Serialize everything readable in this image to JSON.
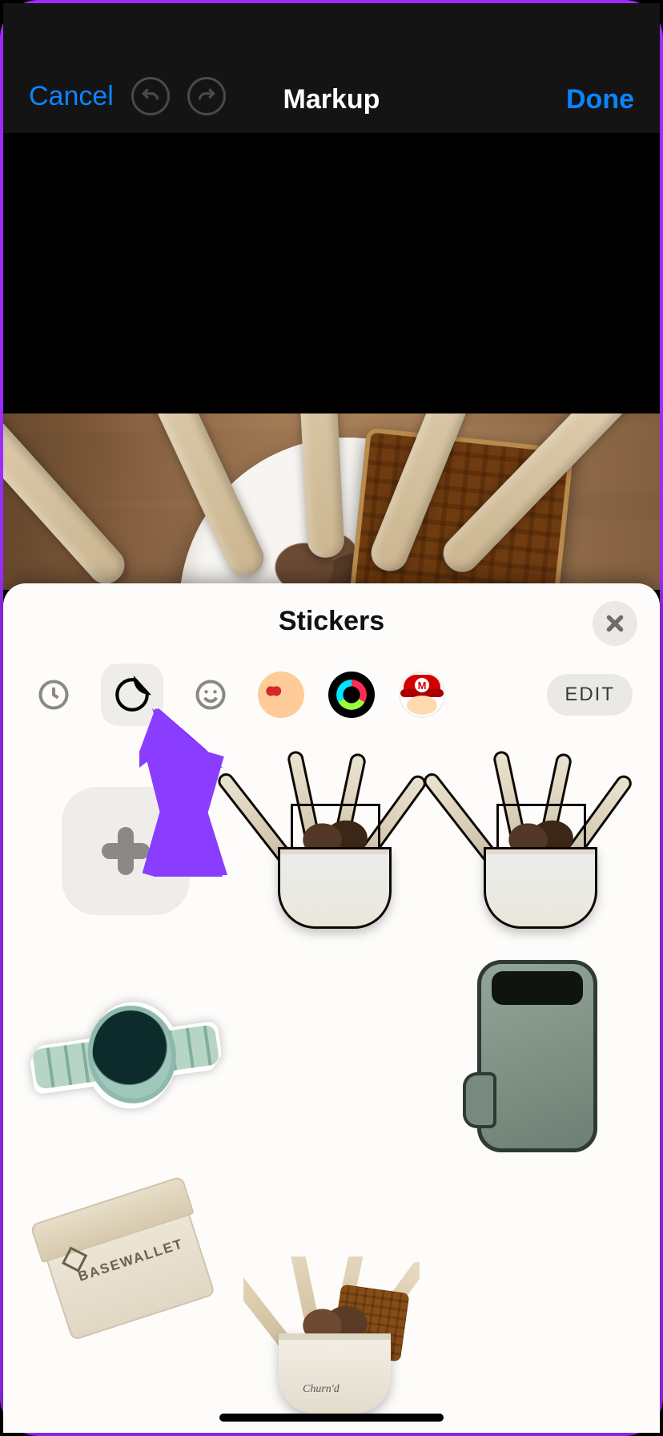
{
  "nav": {
    "cancel": "Cancel",
    "title": "Markup",
    "done": "Done"
  },
  "sheet": {
    "title": "Stickers",
    "edit": "EDIT",
    "categories": [
      {
        "id": "recents",
        "icon": "clock-icon"
      },
      {
        "id": "stickers",
        "icon": "sticker-peel-icon",
        "selected": true
      },
      {
        "id": "emoji",
        "icon": "emoji-smile-icon"
      },
      {
        "id": "memoji",
        "icon": "memoji-icon"
      },
      {
        "id": "fitness",
        "icon": "activity-rings-icon"
      },
      {
        "id": "mario",
        "icon": "mario-icon",
        "badge": "M"
      }
    ],
    "wallet_brand": "BASEWALLET",
    "cup_brand": "Churn'd"
  }
}
